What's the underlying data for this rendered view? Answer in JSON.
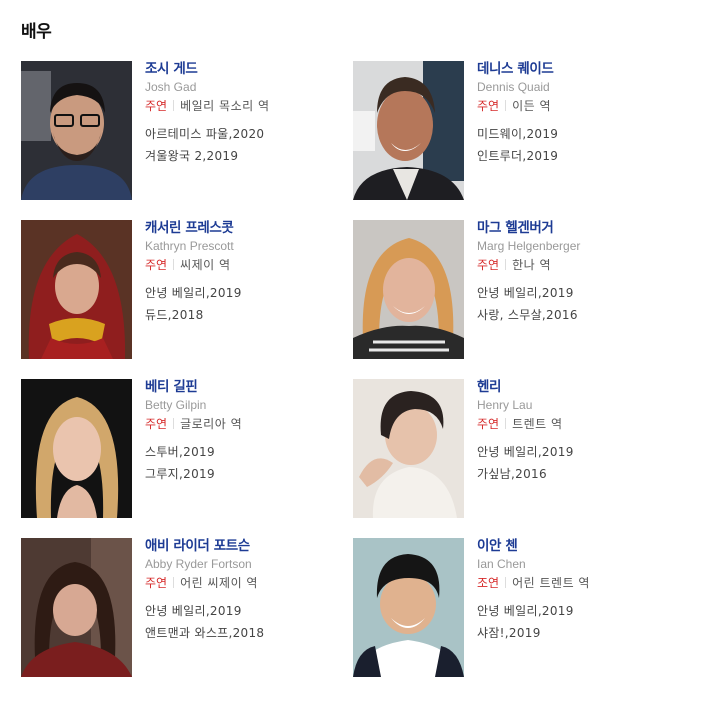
{
  "section": {
    "title": "배우"
  },
  "actors": [
    {
      "korean_name": "조시 게드",
      "english_name": "Josh Gad",
      "role_type": "주연",
      "role_name": "베일리 목소리 역",
      "role_color": "#d62b2b",
      "works": [
        "아르테미스 파울,2020",
        "겨울왕국 2,2019"
      ]
    },
    {
      "korean_name": "데니스 퀘이드",
      "english_name": "Dennis Quaid",
      "role_type": "주연",
      "role_name": "이든 역",
      "role_color": "#d62b2b",
      "works": [
        "미드웨이,2019",
        "인트루더,2019"
      ]
    },
    {
      "korean_name": "캐서린 프레스콧",
      "english_name": "Kathryn Prescott",
      "role_type": "주연",
      "role_name": "씨제이 역",
      "role_color": "#d62b2b",
      "works": [
        "안녕 베일리,2019",
        "듀드,2018"
      ]
    },
    {
      "korean_name": "마그 헬겐버거",
      "english_name": "Marg Helgenberger",
      "role_type": "주연",
      "role_name": "한나 역",
      "role_color": "#d62b2b",
      "works": [
        "안녕 베일리,2019",
        "사랑, 스무살,2016"
      ]
    },
    {
      "korean_name": "베티 길핀",
      "english_name": "Betty Gilpin",
      "role_type": "주연",
      "role_name": "글로리아 역",
      "role_color": "#d62b2b",
      "works": [
        "스투버,2019",
        "그루지,2019"
      ]
    },
    {
      "korean_name": "헨리",
      "english_name": "Henry Lau",
      "role_type": "주연",
      "role_name": "트렌트 역",
      "role_color": "#d62b2b",
      "works": [
        "안녕 베일리,2019",
        "가싶남,2016"
      ]
    },
    {
      "korean_name": "애비 라이더 포트슨",
      "english_name": "Abby Ryder Fortson",
      "role_type": "주연",
      "role_name": "어린 씨제이 역",
      "role_color": "#d62b2b",
      "works": [
        "안녕 베일리,2019",
        "앤트맨과 와스프,2018"
      ]
    },
    {
      "korean_name": "이안 첸",
      "english_name": "Ian Chen",
      "role_type": "조연",
      "role_name": "어린 트렌트 역",
      "role_color": "#d62b2b",
      "works": [
        "안녕 베일리,2019",
        "샤잠!,2019"
      ]
    }
  ]
}
